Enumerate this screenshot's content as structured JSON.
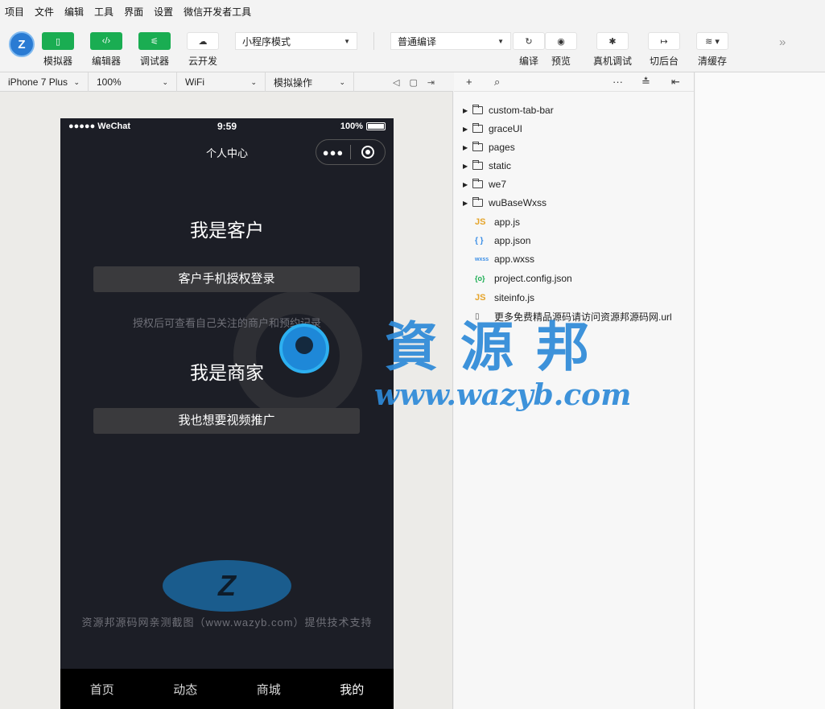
{
  "menu": [
    "项目",
    "文件",
    "编辑",
    "工具",
    "界面",
    "设置",
    "微信开发者工具"
  ],
  "toolbar": {
    "simulator": "模拟器",
    "editor": "编辑器",
    "debugger": "调试器",
    "cloud": "云开发",
    "mode_select": "小程序模式",
    "compile_select": "普通编译",
    "compile": "编译",
    "preview": "预览",
    "real_debug": "真机调试",
    "background": "切后台",
    "clear_cache": "清缓存"
  },
  "device_bar": {
    "device": "iPhone 7 Plus",
    "zoom": "100%",
    "network": "WiFi",
    "operation": "模拟操作"
  },
  "phone": {
    "carrier": "●●●●● WeChat",
    "time": "9:59",
    "battery": "100%",
    "nav_title": "个人中心",
    "customer_title": "我是客户",
    "customer_button": "客户手机授权登录",
    "hint": "授权后可查看自己关注的商户和预约记录",
    "merchant_title": "我是商家",
    "merchant_button": "我也想要视频推广",
    "support_text": "资源邦源码网亲测截图（www.wazyb.com）提供技术支持",
    "tabs": [
      "首页",
      "动态",
      "商城",
      "我的"
    ],
    "active_tab": "我的"
  },
  "file_tree": {
    "folders": [
      "custom-tab-bar",
      "graceUI",
      "pages",
      "static",
      "we7",
      "wuBaseWxss"
    ],
    "files": [
      {
        "name": "app.js",
        "icon": "JS"
      },
      {
        "name": "app.json",
        "icon": "{ }"
      },
      {
        "name": "app.wxss",
        "icon": "wxss"
      },
      {
        "name": "project.config.json",
        "icon": "{o}"
      },
      {
        "name": "siteinfo.js",
        "icon": "JS"
      },
      {
        "name": "更多免费精品源码请访问资源邦源码网.url",
        "icon": "url-file-icon"
      }
    ]
  },
  "watermark": {
    "brand_cn": "資源邦",
    "url": "www.wazyb.com"
  },
  "colors": {
    "accent_green": "#1aad52",
    "phone_bg": "#1c1e26",
    "watermark_blue": "#2e8ad8"
  }
}
